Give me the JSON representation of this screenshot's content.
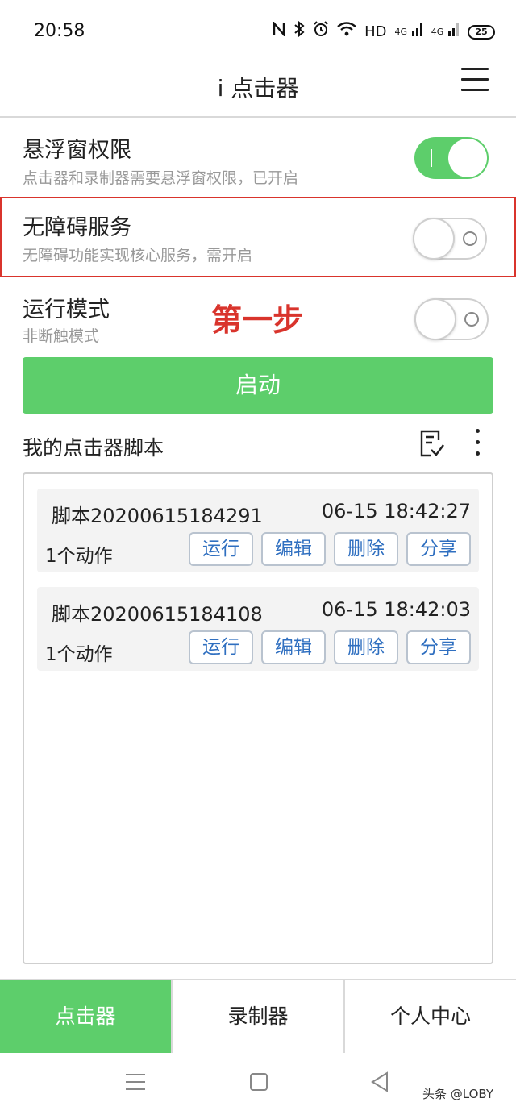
{
  "status_bar": {
    "time": "20:58",
    "icons": [
      "nfc-icon",
      "bluetooth-icon",
      "alarm-icon",
      "wifi-icon"
    ],
    "hd_label": "HD",
    "signal_1": "4G",
    "signal_2": "4G",
    "battery": "25"
  },
  "header": {
    "title": "i 点击器",
    "menu_icon": "menu-icon"
  },
  "settings": [
    {
      "title": "悬浮窗权限",
      "desc": "点击器和录制器需要悬浮窗权限，已开启",
      "enabled": true
    },
    {
      "title": "无障碍服务",
      "desc": "无障碍功能实现核心服务，需开启",
      "enabled": false,
      "highlighted": true
    },
    {
      "title": "运行模式",
      "desc": "非断触模式",
      "enabled": false
    }
  ],
  "annotation": "第一步",
  "start_button": "启动",
  "scripts": {
    "title": "我的点击器脚本",
    "items": [
      {
        "name": "脚本20200615184291",
        "time": "06-15 18:42:27",
        "actions": "1个动作"
      },
      {
        "name": "脚本20200615184108",
        "time": "06-15 18:42:03",
        "actions": "1个动作"
      }
    ],
    "buttons": {
      "run": "运行",
      "edit": "编辑",
      "delete": "删除",
      "share": "分享"
    }
  },
  "tabs": [
    {
      "label": "点击器",
      "active": true
    },
    {
      "label": "录制器",
      "active": false
    },
    {
      "label": "个人中心",
      "active": false
    }
  ],
  "watermark": "头条 @LOBY",
  "colors": {
    "accent_green": "#5dce6b",
    "highlight_red": "#d9342c",
    "button_blue": "#2f6fc0"
  }
}
